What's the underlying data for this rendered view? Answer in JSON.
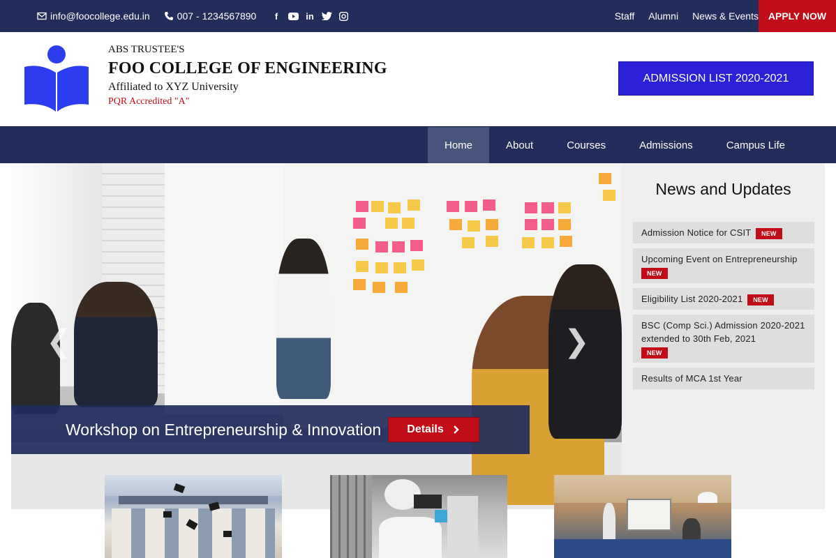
{
  "topbar": {
    "email": "info@foocollege.edu.in",
    "phone": "007 - 1234567890",
    "social_icons": [
      "facebook-icon",
      "youtube-icon",
      "linkedin-icon",
      "twitter-icon",
      "instagram-icon"
    ],
    "links": [
      "Staff",
      "Alumni",
      "News & Events"
    ],
    "apply": "APPLY NOW"
  },
  "header": {
    "trustee": "ABS TRUSTEE'S",
    "college": "FOO COLLEGE OF ENGINEERING",
    "affiliation": "Affiliated to XYZ University",
    "accreditation": "PQR Accredited \"A\"",
    "admission_button": "ADMISSION LIST 2020-2021"
  },
  "nav": {
    "items": [
      "Home",
      "About",
      "Courses",
      "Admissions",
      "Campus Life"
    ],
    "active": "Home"
  },
  "hero": {
    "caption": "Workshop on Entrepreneurship & Innovation",
    "details_label": "Details"
  },
  "news": {
    "title": "News and Updates",
    "badge": "NEW",
    "items": [
      "Admission Notice for CSIT",
      "Upcoming Event on Entrepreneurship",
      "Eligibility List 2020-2021",
      "BSC (Comp Sci.) Admission 2020-2021 extended to 30th Feb, 2021",
      "Results of MCA 1st Year"
    ]
  },
  "colors": {
    "navy": "#222d5c",
    "accent_red": "#c00d17",
    "admission_blue": "#2a21d9",
    "logo_blue": "#2c3df0"
  }
}
